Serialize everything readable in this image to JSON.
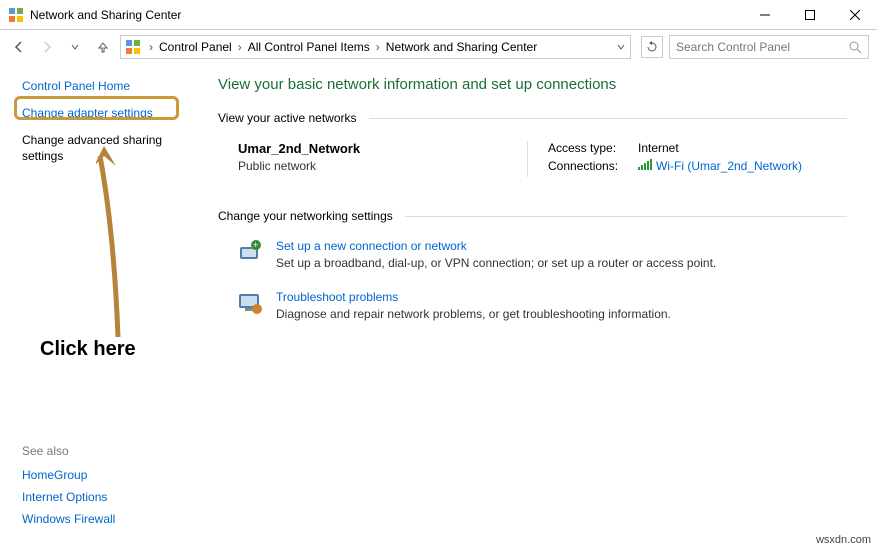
{
  "window": {
    "title": "Network and Sharing Center"
  },
  "breadcrumb": {
    "items": [
      "Control Panel",
      "All Control Panel Items",
      "Network and Sharing Center"
    ]
  },
  "search": {
    "placeholder": "Search Control Panel"
  },
  "sidebar": {
    "home": "Control Panel Home",
    "adapter": "Change adapter settings",
    "advanced": "Change advanced sharing settings"
  },
  "seeAlso": {
    "header": "See also",
    "items": [
      "HomeGroup",
      "Internet Options",
      "Windows Firewall"
    ]
  },
  "main": {
    "heading": "View your basic network information and set up connections",
    "activeHdr": "View your active networks",
    "network": {
      "name": "Umar_2nd_Network",
      "type": "Public network",
      "accessLabel": "Access type:",
      "accessValue": "Internet",
      "connLabel": "Connections:",
      "connValue": "Wi-Fi (Umar_2nd_Network)"
    },
    "changeHdr": "Change your networking settings",
    "opts": [
      {
        "title": "Set up a new connection or network",
        "desc": "Set up a broadband, dial-up, or VPN connection; or set up a router or access point."
      },
      {
        "title": "Troubleshoot problems",
        "desc": "Diagnose and repair network problems, or get troubleshooting information."
      }
    ]
  },
  "annotation": {
    "text": "Click here"
  },
  "watermark": "wsxdn.com"
}
